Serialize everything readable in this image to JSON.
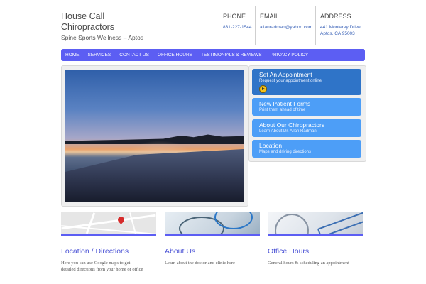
{
  "brand": {
    "line1": "House Call",
    "line2": "Chiropractors",
    "tagline": "Spine Sports Wellness – Aptos"
  },
  "contact": {
    "phone_label": "PHONE",
    "phone": "831-227-1544",
    "email_label": "EMAIL",
    "email": "allanradman@yahoo.com",
    "address_label": "ADDRESS",
    "address_line1": "441 Monterey Drive",
    "address_line2": "Aptos, CA 95003"
  },
  "nav": {
    "items": [
      "HOME",
      "SERVICES",
      "CONTACT US",
      "OFFICE HOURS",
      "TESTIMONIALS & REVIEWS",
      "PRIVACY POLICY"
    ]
  },
  "side_links": [
    {
      "title": "Set An Appointment",
      "sub": "Request your appointment online"
    },
    {
      "title": "New Patient Forms",
      "sub": "Print them ahead of time"
    },
    {
      "title": "About Our Chiropractors",
      "sub": "Learn About Dr. Allan Radman"
    },
    {
      "title": "Location",
      "sub": "Maps and driving directions"
    }
  ],
  "columns": [
    {
      "title": "Location / Directions",
      "text1": "Here you can use Google maps to get",
      "text2": "detailed directions from your home or office"
    },
    {
      "title": "About Us",
      "text1": "Learn about the doctor and clinic here",
      "text2": ""
    },
    {
      "title": "Office Hours",
      "text1": "General hours & scheduling an appointment",
      "text2": ""
    }
  ],
  "colors": {
    "nav": "#5c5ef3",
    "accent_text": "#4e56d6",
    "cta_dark": "#2f74c8",
    "cta_light": "#4d9ef7"
  }
}
